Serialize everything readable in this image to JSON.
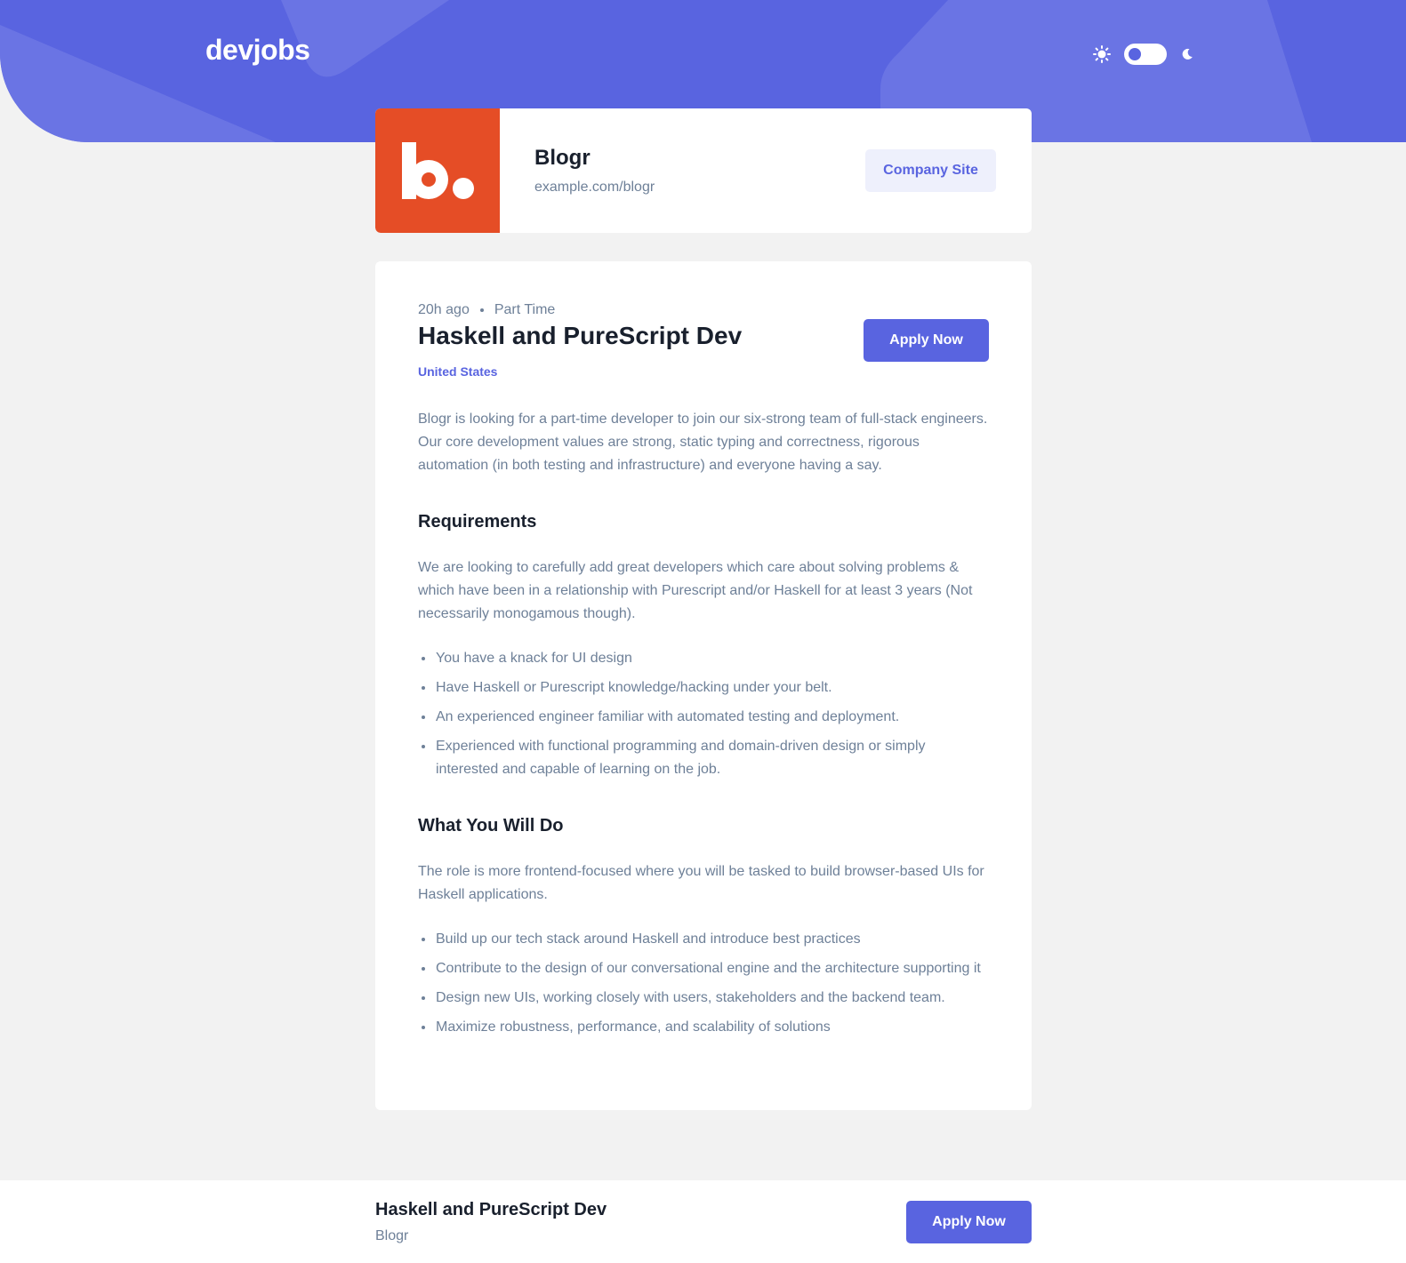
{
  "header": {
    "logo": "devjobs",
    "theme": {
      "light_icon": "sun-icon",
      "dark_icon": "moon-icon",
      "mode": "light"
    }
  },
  "company": {
    "logo_letter": "b.",
    "logo_color": "#e54d26",
    "name": "Blogr",
    "website": "example.com/blogr",
    "site_button": "Company Site"
  },
  "job": {
    "posted": "20h ago",
    "contract": "Part Time",
    "title": "Haskell and PureScript Dev",
    "location": "United States",
    "apply_label": "Apply Now",
    "description": "Blogr is looking for a part-time developer to join our six-strong team of full-stack engineers. Our core development values are strong, static typing and correctness, rigorous automation (in both testing and infrastructure) and everyone having a say.",
    "requirements": {
      "heading": "Requirements",
      "content": "We are looking to carefully add great developers which care about solving problems & which have been in a relationship with Purescript and/or Haskell for at least 3 years (Not necessarily monogamous though).",
      "items": [
        "You have a knack for UI design",
        "Have Haskell or Purescript knowledge/hacking under your belt.",
        "An experienced engineer familiar with automated testing and deployment.",
        "Experienced with functional programming and domain-driven design or simply interested and capable of learning on the job."
      ]
    },
    "role": {
      "heading": "What You Will Do",
      "content": "The role is more frontend-focused where you will be tasked to build browser-based UIs for Haskell applications.",
      "items": [
        "Build up our tech stack around Haskell and introduce best practices",
        "Contribute to the design of our conversational engine and the architecture supporting it",
        "Design new UIs, working closely with users, stakeholders and the backend team.",
        "Maximize robustness, performance, and scalability of solutions"
      ]
    }
  },
  "footer": {
    "title": "Haskell and PureScript Dev",
    "company": "Blogr",
    "apply_label": "Apply Now"
  },
  "colors": {
    "accent": "#5964e0",
    "accent_light": "#eef0fc",
    "heading": "#19202d",
    "body_text": "#6e8098",
    "background": "#f2f2f2"
  }
}
